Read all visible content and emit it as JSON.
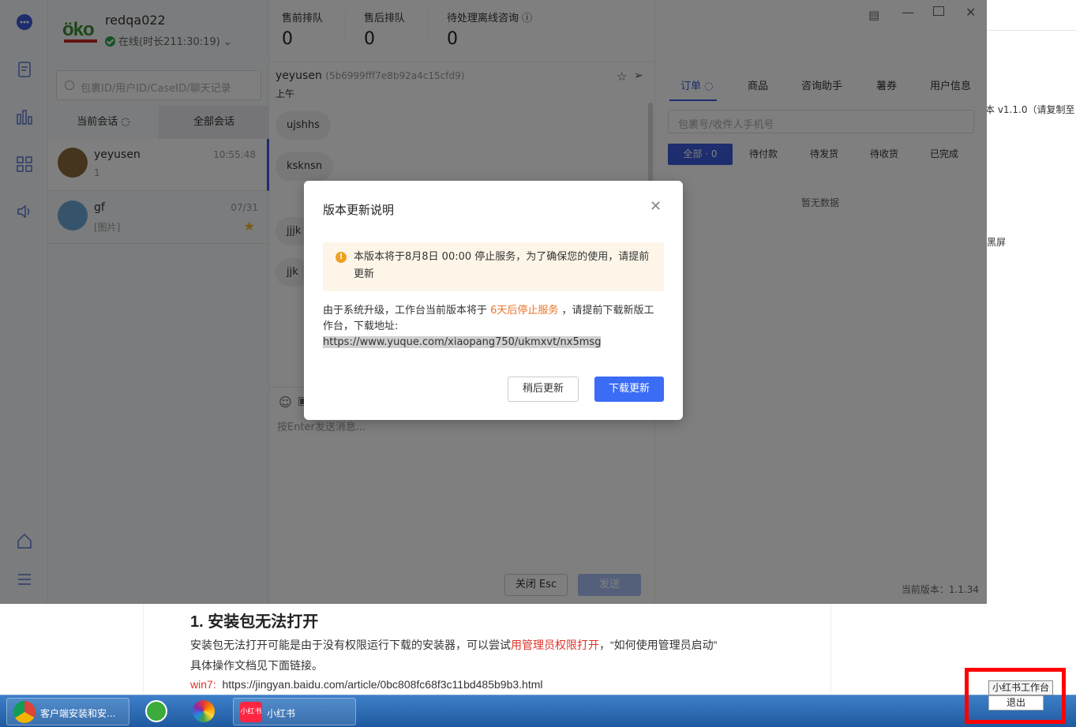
{
  "background": {
    "right_text_version": "本 v1.1.0（请复制至",
    "right_text_blackscreen": "黑屏",
    "doc": {
      "heading": "1. 安装包无法打开",
      "para_prefix": "安装包无法打开可能是由于没有权限运行下载的安装器，可以尝试",
      "para_red": "用管理员权限打开",
      "para_suffix": "，“如何使用管理员启动”",
      "para_line2": "具体操作文档见下面链接。",
      "win7_label": "win7:",
      "win7_link": "https://jingyan.baidu.com/article/0bc808fc68f3c11bd485b9b3.html"
    }
  },
  "app": {
    "logo": "öko",
    "username": "redqa022",
    "status": "在线(时长211:30:19)",
    "queues": [
      {
        "label": "售前排队",
        "value": "0"
      },
      {
        "label": "售后排队",
        "value": "0"
      },
      {
        "label": "待处理离线咨询",
        "value": "0"
      }
    ],
    "search_placeholder": "包裹ID/用户ID/CaseID/聊天记录",
    "conv_tabs": [
      "当前会话",
      "全部会话"
    ],
    "conversations": [
      {
        "name": "yeyusen",
        "time": "10:55:48",
        "sub": "1"
      },
      {
        "name": "gf",
        "time": "07/31",
        "sub": "[图片]"
      }
    ],
    "chat": {
      "user": "yeyusen",
      "user_id": "(5b6999fff7e8b92a4c15cfd9)",
      "last_line": "上午",
      "messages": [
        "ujshhs",
        "ksknsn",
        "jjjk",
        "jjk"
      ],
      "input_placeholder": "按Enter发送消息...",
      "close_label": "关闭 Esc",
      "send_label": "发送"
    },
    "side": {
      "tabs": [
        "订单",
        "商品",
        "咨询助手",
        "薯券",
        "用户信息"
      ],
      "search_placeholder": "包裹号/收件人手机号",
      "filters": [
        "全部 · 0",
        "待付款",
        "待发货",
        "待收货",
        "已完成"
      ],
      "empty": "暂无数据",
      "version": "当前版本：1.1.34"
    }
  },
  "modal": {
    "title": "版本更新说明",
    "warning": "本版本将于8月8日 00:00 停止服务，为了确保您的使用，请提前更新",
    "body_prefix": "由于系统升级，工作台当前版本将于 ",
    "body_highlight": "6天后停止服务",
    "body_middle": " ，请提前下载新版工作台，下载地址: ",
    "body_link": " https://www.yuque.com/xiaopang750/ukmxvt/nx5msg",
    "later_label": "稍后更新",
    "download_label": "下载更新"
  },
  "taskbar": {
    "items": [
      "客户端安装和安...",
      "小红书"
    ],
    "popup_title": "小红书工作台",
    "popup_exit": "退出"
  }
}
